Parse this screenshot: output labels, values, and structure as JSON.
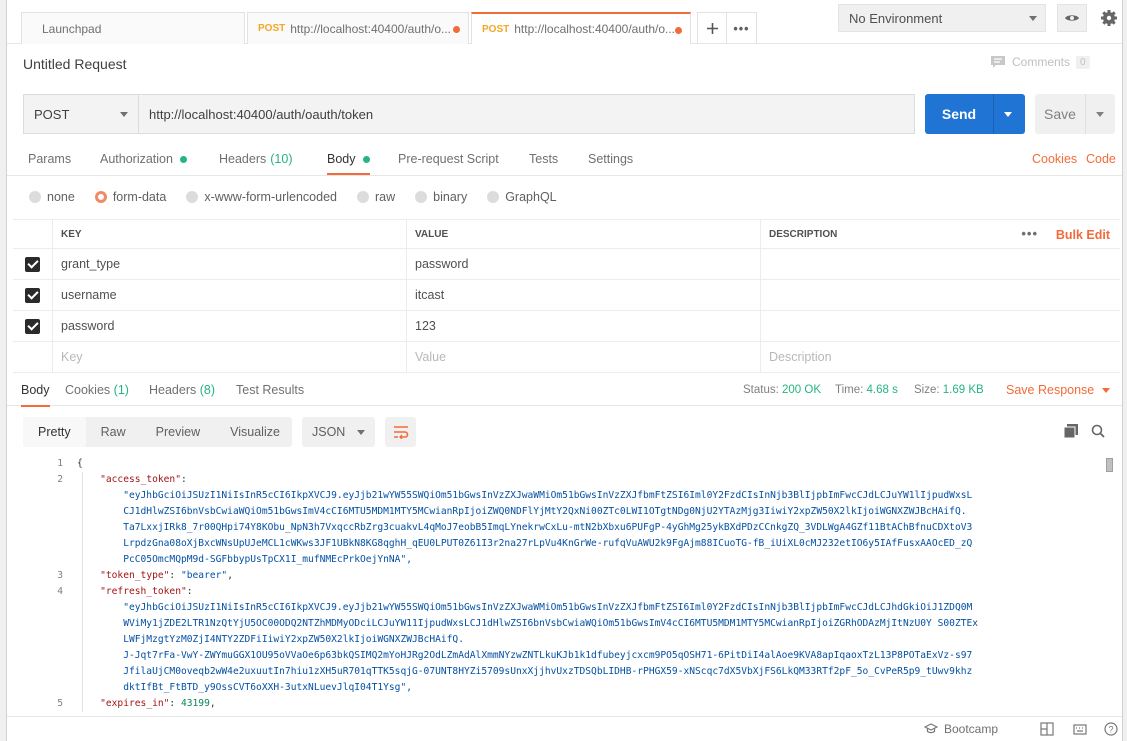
{
  "tabs": [
    {
      "label": "Launchpad"
    },
    {
      "method": "POST",
      "label": "http://localhost:40400/auth/o..."
    },
    {
      "method": "POST",
      "label": "http://localhost:40400/auth/o..."
    }
  ],
  "environment": {
    "selected": "No Environment"
  },
  "request": {
    "title": "Untitled Request",
    "comments_label": "Comments",
    "comments_count": "0",
    "method": "POST",
    "url": "http://localhost:40400/auth/oauth/token",
    "send_label": "Send",
    "save_label": "Save"
  },
  "request_tabs": {
    "params": "Params",
    "authorization": "Authorization",
    "headers": "Headers",
    "headers_count": "(10)",
    "body": "Body",
    "prerequest": "Pre-request Script",
    "tests": "Tests",
    "settings": "Settings",
    "cookies": "Cookies",
    "code": "Code"
  },
  "body_types": [
    "none",
    "form-data",
    "x-www-form-urlencoded",
    "raw",
    "binary",
    "GraphQL"
  ],
  "body_type_selected": "form-data",
  "kv_table": {
    "headers": {
      "key": "KEY",
      "value": "VALUE",
      "description": "DESCRIPTION",
      "bulk_edit": "Bulk Edit"
    },
    "rows": [
      {
        "key": "grant_type",
        "value": "password",
        "checked": true
      },
      {
        "key": "username",
        "value": "itcast",
        "checked": true
      },
      {
        "key": "password",
        "value": "123",
        "checked": true
      }
    ],
    "placeholder": {
      "key": "Key",
      "value": "Value",
      "description": "Description"
    }
  },
  "response": {
    "tabs": {
      "body": "Body",
      "cookies": "Cookies",
      "cookies_count": "(1)",
      "headers": "Headers",
      "headers_count": "(8)",
      "tests": "Test Results"
    },
    "status_label": "Status:",
    "status_value": "200 OK",
    "time_label": "Time:",
    "time_value": "4.68 s",
    "size_label": "Size:",
    "size_value": "1.69 KB",
    "save_label": "Save Response",
    "views": [
      "Pretty",
      "Raw",
      "Preview",
      "Visualize"
    ],
    "format": "JSON"
  },
  "code": {
    "gutter": [
      "1",
      "2",
      "",
      "",
      "",
      "",
      "",
      "3",
      "4",
      "",
      "",
      "",
      "",
      "",
      "",
      "5"
    ],
    "lines": [
      {
        "t": "{"
      },
      {
        "t": "    \"access_token\": "
      },
      {
        "t": "        \"eyJhbGciOiJSUzI1NiIsInR5cCI6IkpXVCJ9.eyJjb21wYW55SWQiOm51bGwsInVzZXJwaWMiOm51bGwsInVzZXJfbmFtZSI6Iml0Y2FzdCIsInNjb3BlIjpbImFwcCJdLCJuYW1lIjpudWxsL"
      },
      {
        "t": "        CJ1dHlwZSI6bnVsbCwiaWQiOm51bGwsImV4cCI6MTU5MDM1MTY5MCwianRpIjoiZWQ0NDFlYjMtY2QxNi00ZTc0LWI1OTgtNDg0NjU2YTAzMjg3IiwiY2xpZW50X2lkIjoiWGNXZWJBcHAifQ."
      },
      {
        "t": "        Ta7LxxjIRk8_7r00QHpi74Y8KObu_NpN3h7VxqccRbZrg3cuakvL4qMoJ7eobB5ImqLYnekrwCxLu-mtN2bXbxu6PUFgP-4yGhMg25ykBXdPDzCCnkgZQ_3VDLWgA4GZf11BtAChBfnuCDXtoV3"
      },
      {
        "t": "        LrpdzGna08oXjBxcWNsUpUJeMCL1cWKws3JF1UBkN8KG8qghH_qEU0LPUT0Z61I3r2na27rLpVu4KnGrWe-rufqVuAWU2k9FgAjm88ICuoTG-fB_iUiXL0cMJ232etIO6y5IAfFusxAAOcED_zQ"
      },
      {
        "t": "        PcC05OmcMQpM9d-SGFbbypUsTpCX1I_mufNMEcPrkOejYnNA\","
      },
      {
        "t": "    \"token_type\": \"bearer\","
      },
      {
        "t": "    \"refresh_token\": "
      },
      {
        "t": "        \"eyJhbGciOiJSUzI1NiIsInR5cCI6IkpXVCJ9.eyJjb21wYW55SWQiOm51bGwsInVzZXJwaWMiOm51bGwsInVzZXJfbmFtZSI6Iml0Y2FzdCIsInNjb3BlIjpbImFwcCJdLCJhdGkiOiJ1ZDQ0M"
      },
      {
        "t": "        WViMy1jZDE2LTR1NzQtYjU5OC00ODQ2NTZhMDMyODciLCJuYW11IjpudWxsLCJ1dHlwZSI6bnVsbCwiaWQiOm51bGwsImV4cCI6MTU5MDM1MTY5MCwianRpIjoiZGRhODAzMjItNzU0Y S00ZTEx"
      },
      {
        "t": "        LWFjMzgtYzM0ZjI4NTY2ZDFiIiwiY2xpZW50X2lkIjoiWGNXZWJBcHAifQ."
      },
      {
        "t": "        J-Jqt7rFa-VwY-ZWYmuGGX1OU95oVVaOe6p63bkQSIMQ2mYoHJRg2OdLZmAdAlXmmNYzwZNTLkuKJb1k1dfubeyjcxcm9PO5qOSH71-6PitDiI4alAoe9KVA8apIqaoxTzL13P8POTaExVz-s97"
      },
      {
        "t": "        JfilaUjCM0oveqb2wW4e2uxuutIn7hiu1zXH5uR701qTTK5sqjG-07UNT8HYZi5709sUnxXjjhvUxzTDSQbLIDHB-rPHGX59-xNScqc7dX5VbXjFS6LkQM33RTf2pF_5o_CvPeR5p9_tUwv9khz"
      },
      {
        "t": "        dktIfBt_FtBTD_y9OssCVT6oXXH-3utxNLuevJlqI04T1Ysg\","
      },
      {
        "t": "    \"expires_in\": 43199,"
      }
    ]
  },
  "statusbar": {
    "bootcamp": "Bootcamp"
  }
}
